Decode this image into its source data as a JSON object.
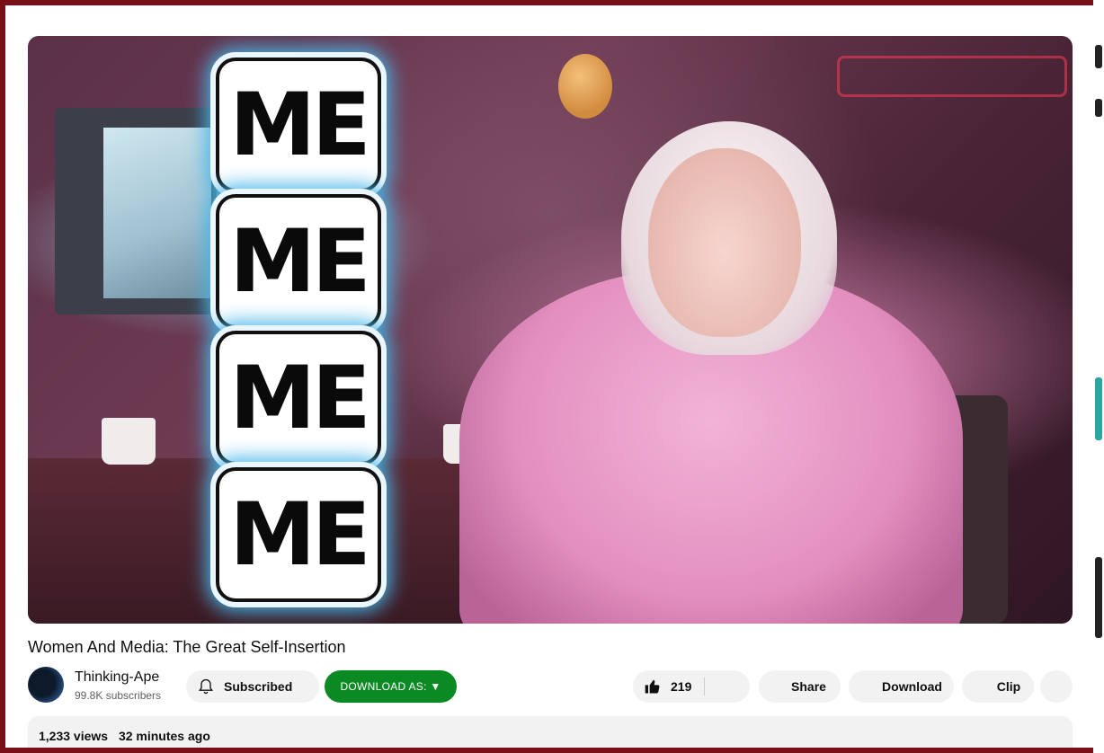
{
  "video": {
    "overlay_words": [
      "ME",
      "ME",
      "ME",
      "ME"
    ],
    "title": "Women And Media: The Great Self-Insertion"
  },
  "channel": {
    "name": "Thinking-Ape",
    "subscribers": "99.8K subscribers",
    "subscribe_label": "Subscribed"
  },
  "actions": {
    "download_as_label": "DOWNLOAD AS: ▼",
    "like_count": "219",
    "share_label": "Share",
    "download_label": "Download",
    "clip_label": "Clip"
  },
  "description": {
    "views": "1,233 views",
    "posted": "32 minutes ago"
  },
  "colors": {
    "frame": "#7a1017",
    "download_as_bg": "#0b8a23",
    "overlay_glow": "#47b6e8"
  }
}
